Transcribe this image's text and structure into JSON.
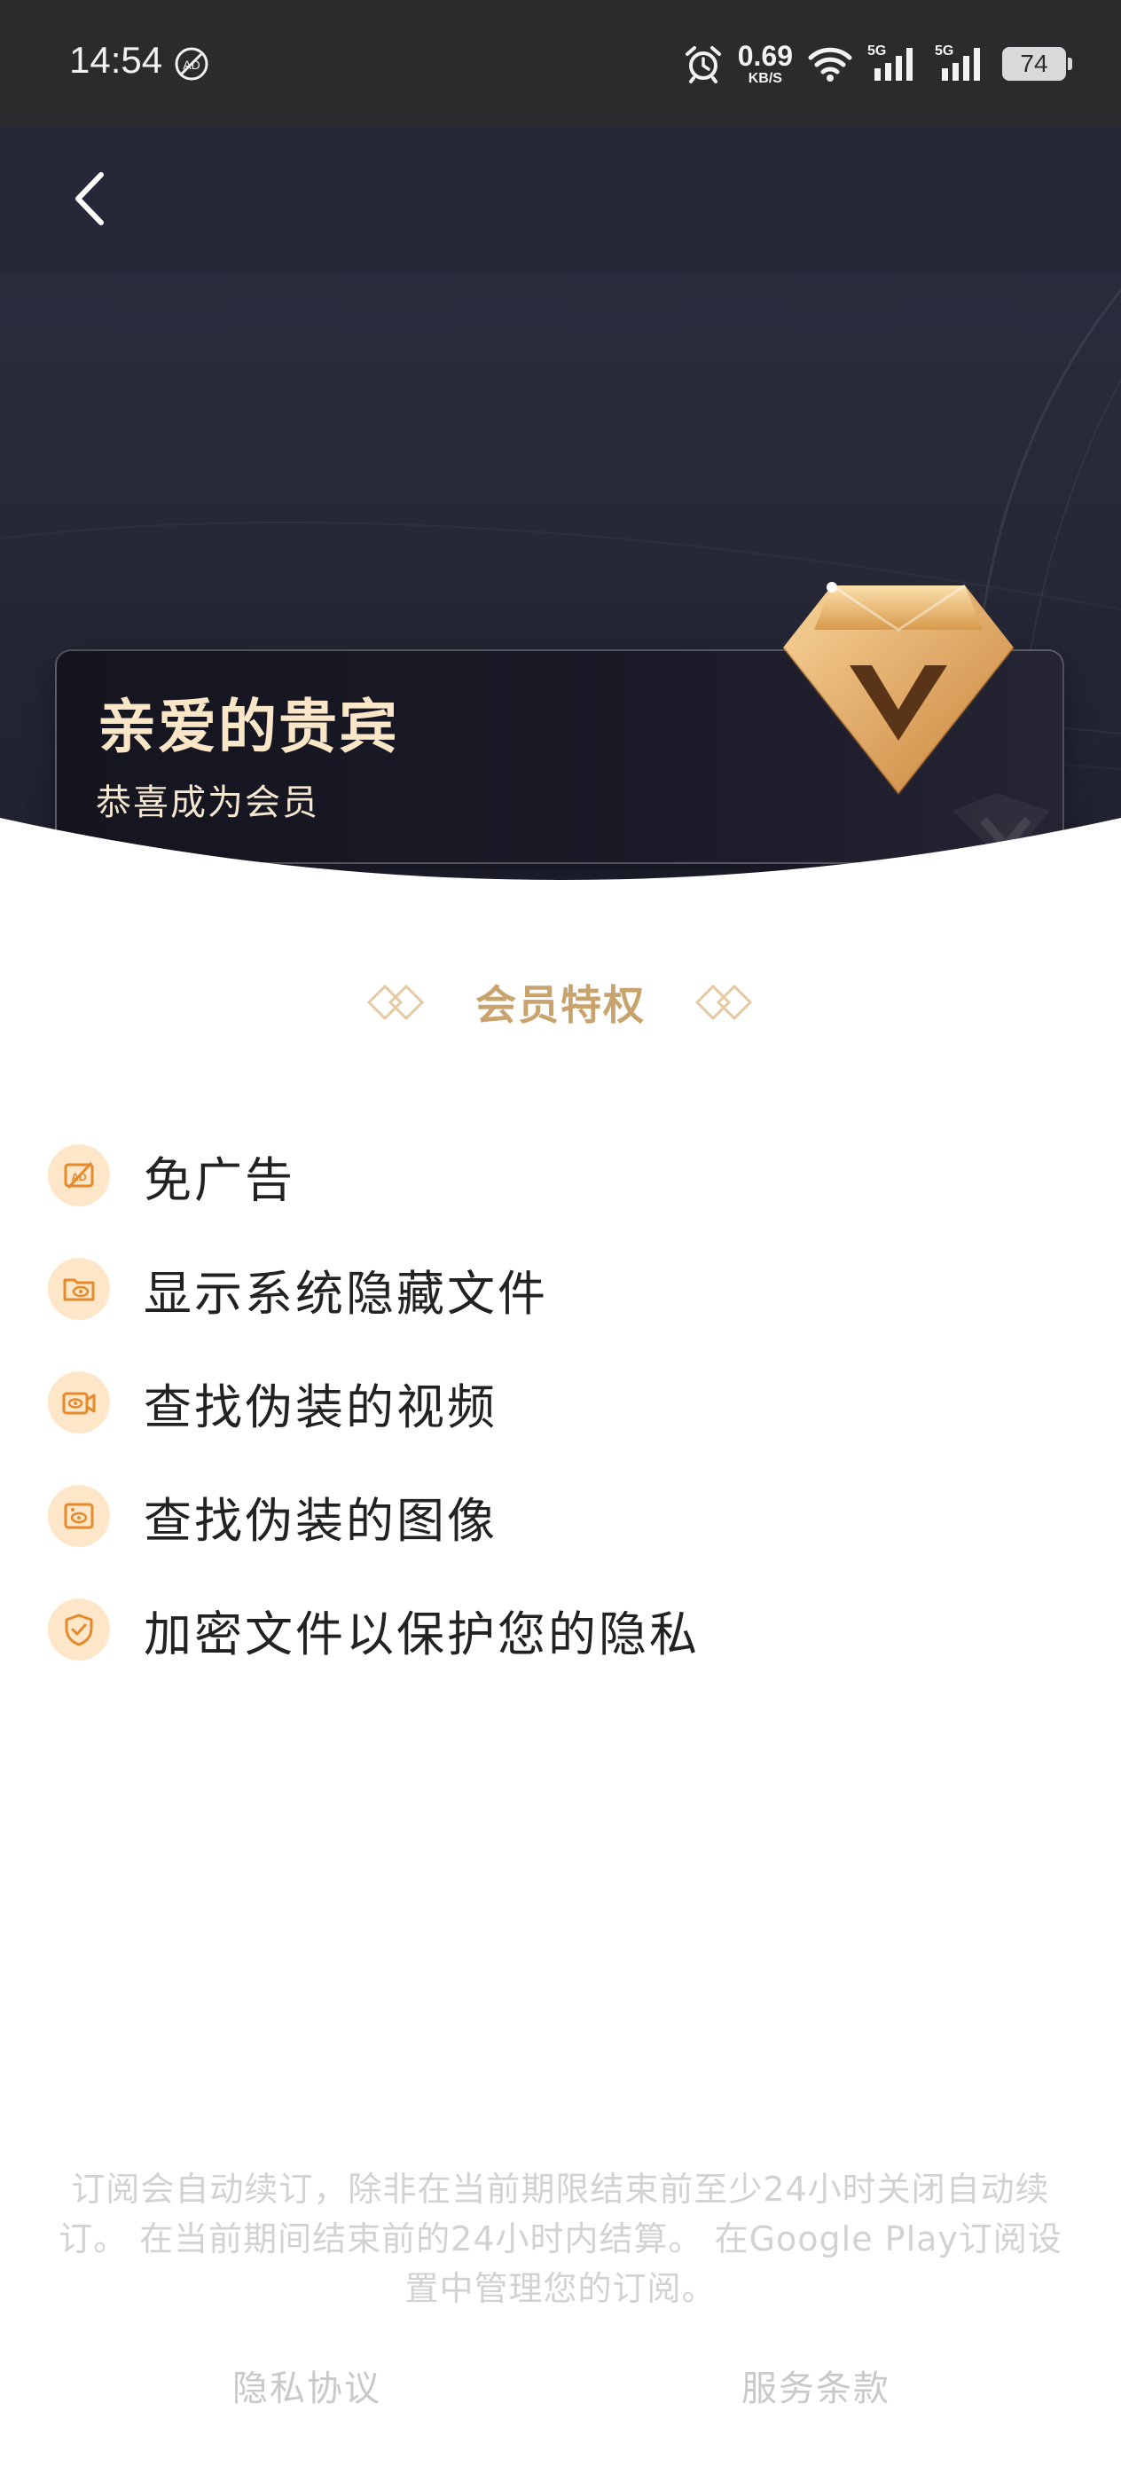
{
  "status_bar": {
    "time": "14:54",
    "net_speed_value": "0.69",
    "net_speed_unit": "KB/S",
    "signal_1_label": "5G",
    "signal_2_label": "5G",
    "battery": "74",
    "icons": [
      "ad-blocked-icon",
      "alarm-icon",
      "wifi-icon",
      "cellular-signal-icon",
      "battery-icon"
    ]
  },
  "header": {
    "back_icon": "chevron-left-icon"
  },
  "vip_card": {
    "title": "亲爱的贵宾",
    "subtitle": "恭喜成为会员",
    "emblem": "v-diamond-icon"
  },
  "privileges": {
    "title": "会员特权",
    "items": [
      {
        "label": "免广告",
        "icon": "no-ad-icon"
      },
      {
        "label": "显示系统隐藏文件",
        "icon": "hidden-folder-icon"
      },
      {
        "label": "查找伪装的视频",
        "icon": "hidden-video-icon"
      },
      {
        "label": "查找伪装的图像",
        "icon": "hidden-image-icon"
      },
      {
        "label": "加密文件以保护您的隐私",
        "icon": "shield-check-icon"
      }
    ]
  },
  "subscription_notice": "订阅会自动续订，除非在当前期限结束前至少24小时关闭自动续订。 在当前期间结束前的24小时内结算。 在Google Play订阅设置中管理您的订阅。",
  "footer": {
    "privacy_label": "隐私协议",
    "terms_label": "服务条款"
  },
  "colors": {
    "hero_bg": "#262838",
    "gold_accent": "#c9a36d",
    "icon_bg": "#fde7c8",
    "card_title": "#fbe7c8"
  }
}
